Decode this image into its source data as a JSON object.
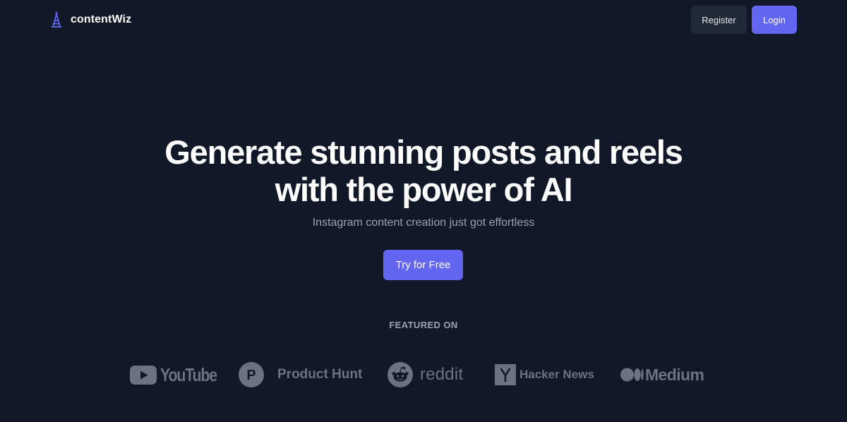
{
  "brand": {
    "name": "contentWiz",
    "logo_icon": "tower-icon",
    "logo_color": "#6366f1"
  },
  "nav": {
    "register_label": "Register",
    "login_label": "Login"
  },
  "hero": {
    "title_line1": "Generate stunning posts and reels",
    "title_line2": "with the power of AI",
    "subtitle": "Instagram content creation just got effortless",
    "cta_label": "Try for Free"
  },
  "featured": {
    "label": "FEATURED ON",
    "logos": [
      {
        "name": "YouTube",
        "icon": "youtube-icon"
      },
      {
        "name": "Product Hunt",
        "icon": "product-hunt-icon"
      },
      {
        "name": "reddit",
        "icon": "reddit-icon"
      },
      {
        "name": "Hacker News",
        "icon": "hacker-news-icon"
      },
      {
        "name": "Medium",
        "icon": "medium-icon"
      }
    ]
  },
  "colors": {
    "background": "#111827",
    "accent": "#6366f1",
    "secondary_button": "#1f2937",
    "muted_text": "#9ca3af",
    "logo_gray": "#6b7280"
  }
}
